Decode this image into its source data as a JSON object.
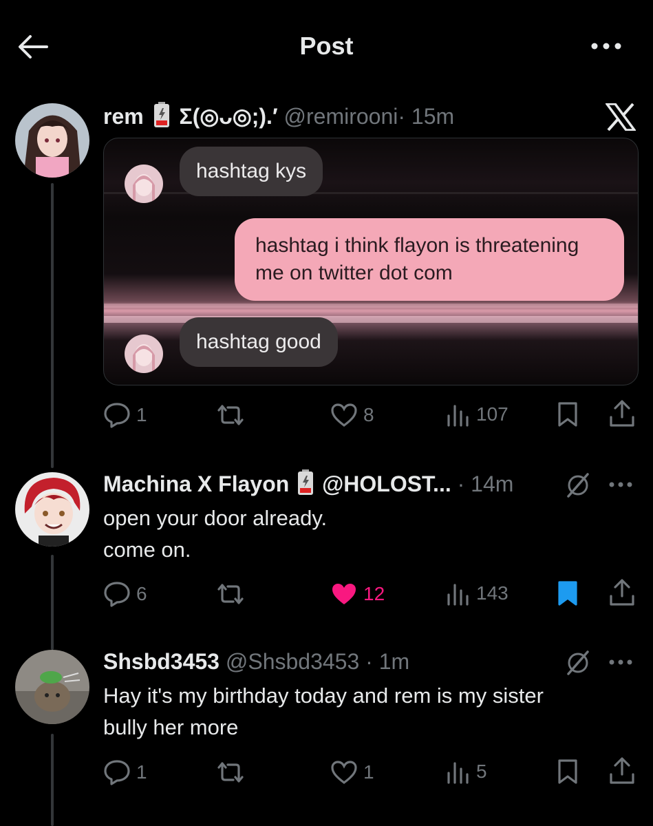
{
  "header": {
    "title": "Post"
  },
  "colors": {
    "like_pink": "#f91880",
    "bookmark_blue": "#1d9bf0",
    "muted": "#71767b"
  },
  "tweets": [
    {
      "name": "rem",
      "name_suffix": "Σ(◎ᴗ◎;).′",
      "handle": "@remirooni",
      "time": "· 15m",
      "badge": "x-logo-icon",
      "media": {
        "bubble1": "hashtag kys",
        "bubble2": "hashtag i think flayon is threatening me on twitter dot com",
        "bubble3": "hashtag good"
      },
      "stats": {
        "replies": "1",
        "likes": "8",
        "views": "107"
      }
    },
    {
      "name": "Machina X Flayon",
      "handle": "@HOLOST...",
      "time": "· 14m",
      "text_line1": "open your door already.",
      "text_line2": "come on.",
      "stats": {
        "replies": "6",
        "likes": "12",
        "views": "143"
      },
      "liked": true,
      "bookmarked": true
    },
    {
      "name": "Shsbd3453",
      "handle": "@Shsbd3453",
      "time": "· 1m",
      "text_line1": "Hay it's my birthday today and rem is my sister",
      "text_line2": "bully her more",
      "stats": {
        "replies": "1",
        "likes": "1",
        "views": "5"
      }
    }
  ]
}
